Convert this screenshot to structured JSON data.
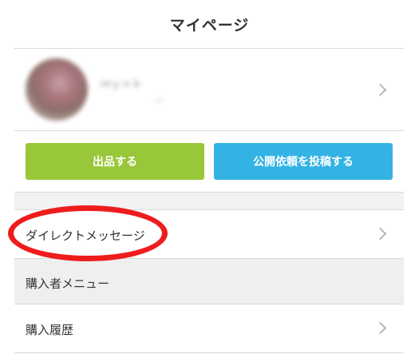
{
  "header": {
    "title": "マイページ"
  },
  "profile": {
    "name": "ｍｙｎｋ",
    "sub": "—"
  },
  "actions": {
    "sell_label": "出品する",
    "post_label": "公開依頼を投稿する"
  },
  "menu": {
    "direct_message": "ダイレクトメッセージ",
    "buyer_section": "購入者メニュー",
    "purchase_history": "購入履歴"
  },
  "colors": {
    "sell_button": "#99c73a",
    "post_button": "#33b3e4",
    "annotation_circle": "#ee1c1c"
  }
}
